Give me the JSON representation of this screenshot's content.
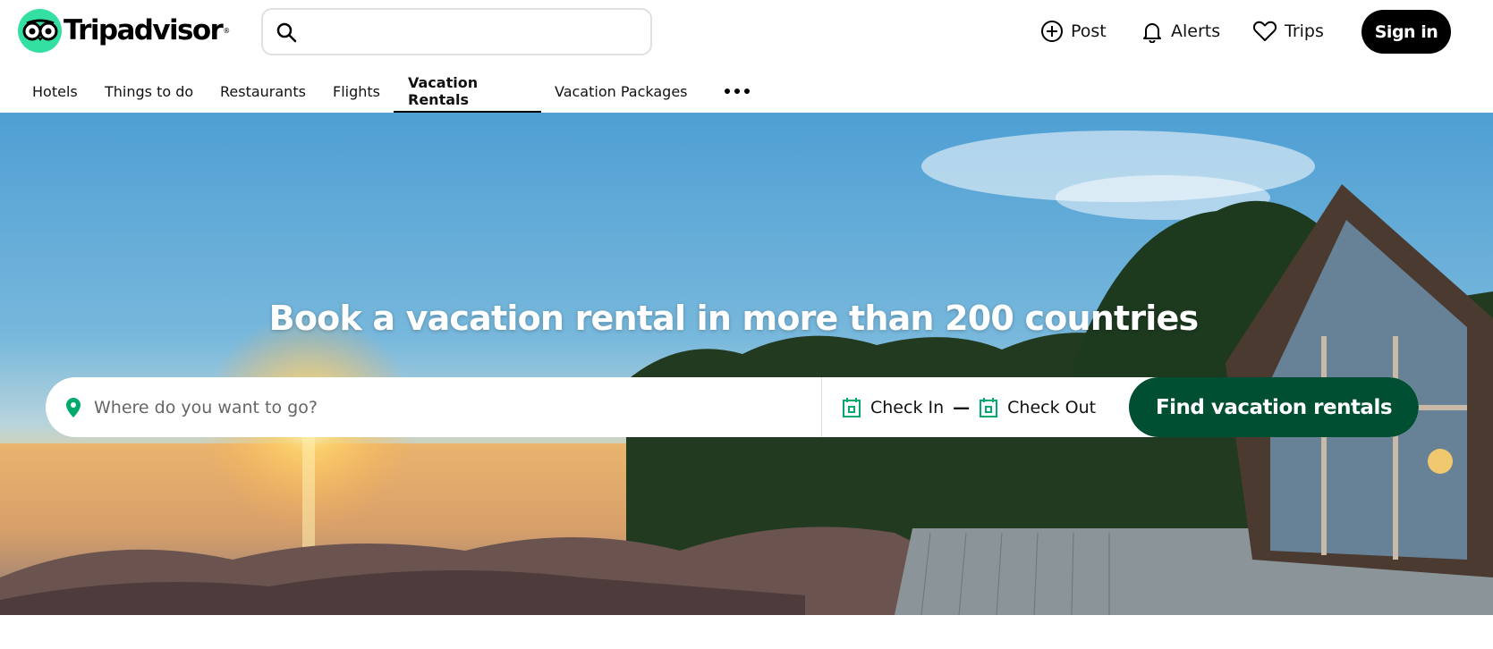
{
  "brand": {
    "name": "Tripadvisor",
    "accent": "#34e0a1",
    "dark_green": "#004f32"
  },
  "header": {
    "search": {
      "placeholder": "",
      "icon": "search-icon"
    },
    "links": [
      {
        "label": "Post",
        "icon": "plus-circle-icon"
      },
      {
        "label": "Alerts",
        "icon": "bell-icon"
      },
      {
        "label": "Trips",
        "icon": "heart-icon"
      }
    ],
    "signin_label": "Sign in"
  },
  "nav": {
    "items": [
      {
        "label": "Hotels"
      },
      {
        "label": "Things to do"
      },
      {
        "label": "Restaurants"
      },
      {
        "label": "Flights"
      },
      {
        "label": "Vacation Rentals",
        "active": true
      },
      {
        "label": "Vacation Packages"
      }
    ],
    "more_icon": "more-dots-icon"
  },
  "hero": {
    "title": "Book a vacation rental in more than 200 countries",
    "where_placeholder": "Where do you want to go?",
    "check_in": "Check In",
    "check_out": "Check Out",
    "separator": "—",
    "find_label": "Find vacation rentals"
  }
}
